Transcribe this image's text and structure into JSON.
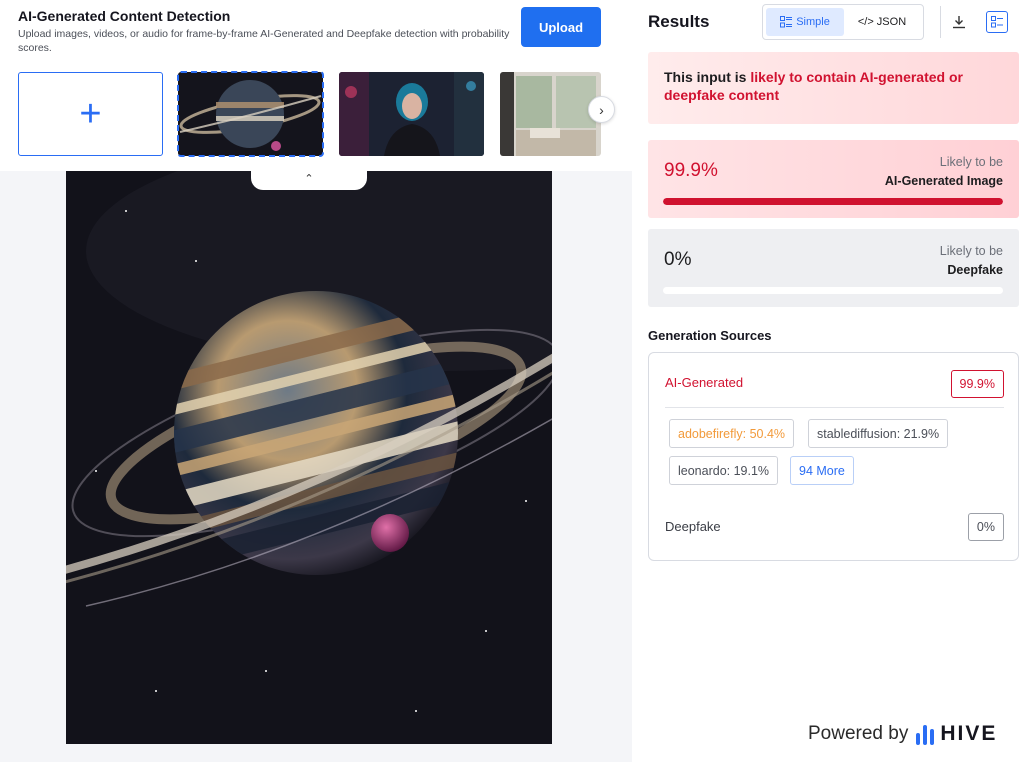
{
  "header": {
    "title": "AI-Generated Content Detection",
    "description": "Upload images, videos, or audio for frame-by-frame AI-Generated and Deepfake detection with probability scores.",
    "upload_label": "Upload"
  },
  "gallery": {
    "add_symbol": "+",
    "next_symbol": "›",
    "collapse_symbol": "⌃"
  },
  "results": {
    "title": "Results",
    "view_simple": "Simple",
    "view_json": "</> JSON",
    "verdict_prefix": "This input is ",
    "verdict_highlight": "likely to contain AI-generated or deepfake content",
    "ai_card": {
      "percent": "99.9%",
      "likely": "Likely to be",
      "label": "AI-Generated Image",
      "fill": 0.999
    },
    "deepfake_card": {
      "percent": "0%",
      "likely": "Likely to be",
      "label": "Deepfake",
      "fill": 0
    },
    "generation_sources_title": "Generation Sources",
    "ai_generated_label": "AI-Generated",
    "ai_generated_pct": "99.9%",
    "sources": [
      {
        "label": "adobefirefly: 50.4%"
      },
      {
        "label": "stablediffusion: 21.9%"
      },
      {
        "label": "leonardo: 19.1%"
      },
      {
        "label": "94 More"
      }
    ],
    "deepfake_label": "Deepfake",
    "deepfake_pct": "0%"
  },
  "footer": {
    "powered_by": "Powered by",
    "brand": "HIVE"
  },
  "colors": {
    "accent_blue": "#2a6df4",
    "alert_red": "#d11230",
    "source_orange": "#f29a3a"
  },
  "icons": {
    "simple_view": "list-view-icon",
    "download": "download-icon",
    "layout": "layout-toggle-icon"
  }
}
